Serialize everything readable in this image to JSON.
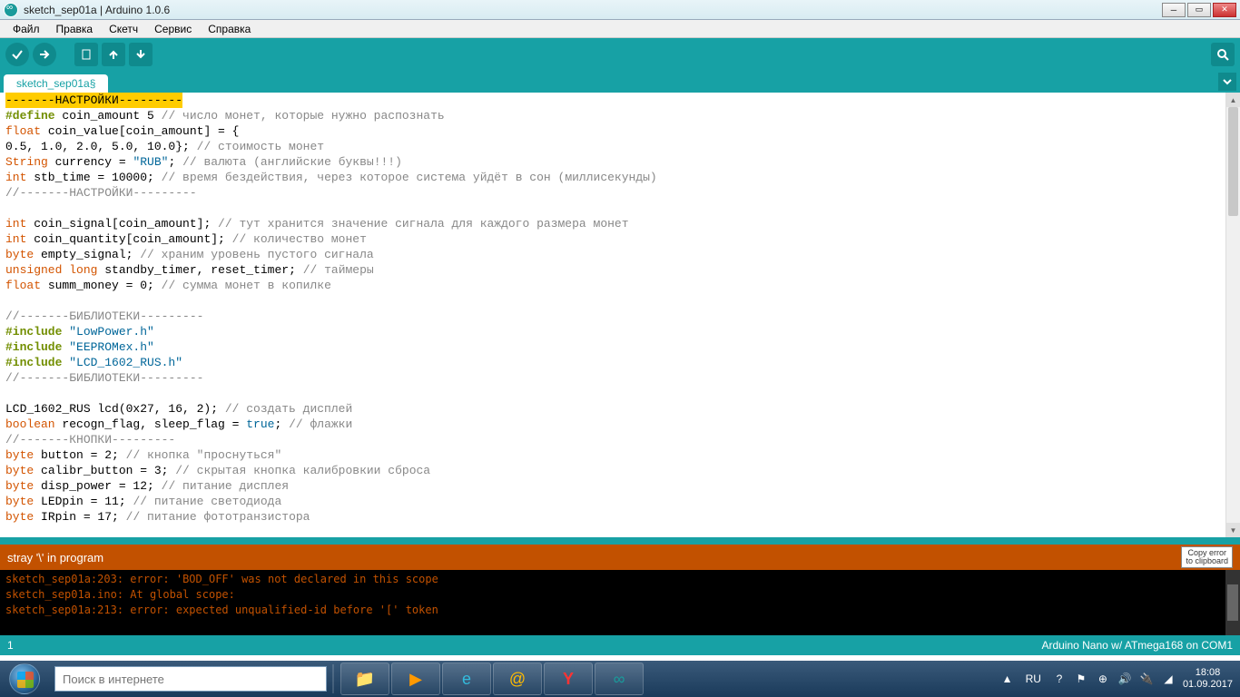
{
  "window": {
    "title": "sketch_sep01a | Arduino 1.0.6"
  },
  "menu": {
    "items": [
      "Файл",
      "Правка",
      "Скетч",
      "Сервис",
      "Справка"
    ]
  },
  "tabs": {
    "active": "sketch_sep01a",
    "dirty_marker": "§"
  },
  "errors": {
    "summary": "stray '\\' in program",
    "copy_label": "Copy error\nto clipboard",
    "lines": [
      "sketch_sep01a:203: error: 'BOD_OFF' was not declared in this scope",
      "sketch_sep01a.ino: At global scope:",
      "sketch_sep01a:213: error: expected unqualified-id before '[' token"
    ]
  },
  "status": {
    "line": "1",
    "board": "Arduino Nano w/ ATmega168 on COM1"
  },
  "code": {
    "line01_hl": "-------НАСТРОЙКИ---------",
    "line02_a": "#define",
    "line02_b": " coin_amount 5 ",
    "line02_c": "// число монет, которые нужно распознать",
    "line03_a": "float",
    "line03_b": " coin_value[coin_amount] = {",
    "line04_a": "0.5, 1.0, 2.0, 5.0, 10.0}; ",
    "line04_b": "// стоимость монет",
    "line05_a": "String",
    "line05_b": " currency = ",
    "line05_c": "\"RUB\"",
    "line05_d": "; ",
    "line05_e": "// валюта (английские буквы!!!)",
    "line06_a": "int",
    "line06_b": " stb_time = 10000; ",
    "line06_c": "// время бездействия, через которое система уйдёт в сон (миллисекунды)",
    "line07": "//-------НАСТРОЙКИ---------",
    "line09_a": "int",
    "line09_b": " coin_signal[coin_amount]; ",
    "line09_c": "// тут хранится значение сигнала для каждого размера монет",
    "line10_a": "int",
    "line10_b": " coin_quantity[coin_amount]; ",
    "line10_c": "// количество монет",
    "line11_a": "byte",
    "line11_b": " empty_signal; ",
    "line11_c": "// храним уровень пустого сигнала",
    "line12_a": "unsigned",
    "line12_b": " ",
    "line12_c": "long",
    "line12_d": " standby_timer, reset_timer; ",
    "line12_e": "// таймеры",
    "line13_a": "float",
    "line13_b": " summ_money = 0; ",
    "line13_c": "// сумма монет в копилке",
    "line15": "//-------БИБЛИОТЕКИ---------",
    "line16_a": "#include ",
    "line16_b": "\"LowPower.h\"",
    "line17_a": "#include ",
    "line17_b": "\"EEPROMex.h\"",
    "line18_a": "#include ",
    "line18_b": "\"LCD_1602_RUS.h\"",
    "line19": "//-------БИБЛИОТЕКИ---------",
    "line21_a": "LCD_1602_RUS lcd(0x27, 16, 2); ",
    "line21_b": "// создать дисплей",
    "line22_a": "boolean",
    "line22_b": " recogn_flag, sleep_flag = ",
    "line22_c": "true",
    "line22_d": "; ",
    "line22_e": "// флажки",
    "line23": "//-------КНОПКИ---------",
    "line24_a": "byte",
    "line24_b": " button = 2; ",
    "line24_c": "// кнопка \"проснуться\"",
    "line25_a": "byte",
    "line25_b": " calibr_button = 3; ",
    "line25_c": "// скрытая кнопка калибровкии сброса",
    "line26_a": "byte",
    "line26_b": " disp_power = 12; ",
    "line26_c": "// питание дисплея",
    "line27_a": "byte",
    "line27_b": " LEDpin = 11; ",
    "line27_c": "// питание светодиода",
    "line28_a": "byte",
    "line28_b": " IRpin = 17; ",
    "line28_c": "// питание фототранзистора"
  },
  "taskbar": {
    "search_placeholder": "Поиск в интернете",
    "lang": "RU",
    "time": "18:08",
    "date": "01.09.2017"
  }
}
